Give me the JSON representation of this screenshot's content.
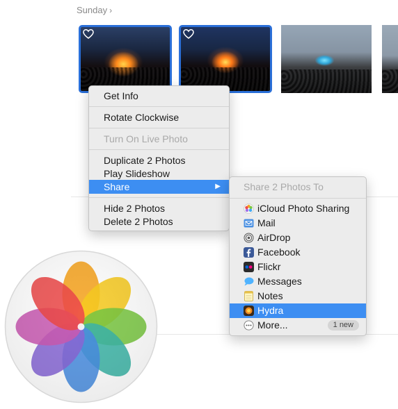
{
  "section": {
    "title": "Sunday",
    "chevron": "›"
  },
  "context_menu": {
    "items": [
      {
        "label": "Get Info"
      },
      {
        "label": "Rotate Clockwise"
      },
      {
        "label": "Turn On Live Photo"
      },
      {
        "label": "Duplicate 2 Photos"
      },
      {
        "label": "Play Slideshow"
      },
      {
        "label": "Share"
      },
      {
        "label": "Hide 2 Photos"
      },
      {
        "label": "Delete 2 Photos"
      }
    ],
    "submenu_arrow": "▶"
  },
  "share_menu": {
    "title": "Share 2 Photos To",
    "items": [
      {
        "label": "iCloud Photo Sharing",
        "icon": "icloud-photo-sharing-icon"
      },
      {
        "label": "Mail",
        "icon": "mail-icon"
      },
      {
        "label": "AirDrop",
        "icon": "airdrop-icon"
      },
      {
        "label": "Facebook",
        "icon": "facebook-icon"
      },
      {
        "label": "Flickr",
        "icon": "flickr-icon"
      },
      {
        "label": "Messages",
        "icon": "messages-icon"
      },
      {
        "label": "Notes",
        "icon": "notes-icon"
      },
      {
        "label": "Hydra",
        "icon": "hydra-icon"
      },
      {
        "label": "More...",
        "icon": "more-icon",
        "badge": "1 new"
      }
    ]
  },
  "colors": {
    "selection": "#2a6fd8",
    "menu_highlight": "#3d8ef2"
  }
}
